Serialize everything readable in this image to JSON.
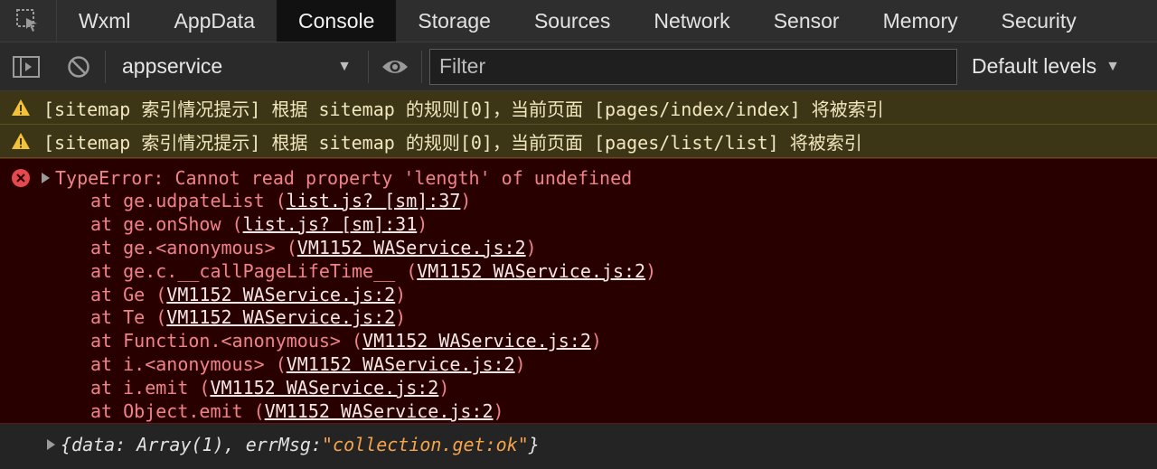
{
  "tabs": [
    {
      "label": "Wxml"
    },
    {
      "label": "AppData"
    },
    {
      "label": "Console",
      "active": true
    },
    {
      "label": "Storage"
    },
    {
      "label": "Sources"
    },
    {
      "label": "Network"
    },
    {
      "label": "Sensor"
    },
    {
      "label": "Memory"
    },
    {
      "label": "Security"
    }
  ],
  "toolbar": {
    "context": "appservice",
    "filter_placeholder": "Filter",
    "levels": "Default levels"
  },
  "console": {
    "warnings": [
      "[sitemap 索引情况提示] 根据 sitemap 的规则[0]，当前页面 [pages/index/index] 将被索引",
      "[sitemap 索引情况提示] 根据 sitemap 的规则[0]，当前页面 [pages/list/list] 将被索引"
    ],
    "error": {
      "message": "TypeError: Cannot read property 'length' of undefined",
      "frames": [
        {
          "fn": "at ge.udpateList (",
          "link": "list.js? [sm]:37",
          "end": ")"
        },
        {
          "fn": "at ge.onShow (",
          "link": "list.js? [sm]:31",
          "end": ")"
        },
        {
          "fn": "at ge.<anonymous> (",
          "link": "VM1152 WAService.js:2",
          "end": ")"
        },
        {
          "fn": "at ge.c.__callPageLifeTime__ (",
          "link": "VM1152 WAService.js:2",
          "end": ")"
        },
        {
          "fn": "at Ge (",
          "link": "VM1152 WAService.js:2",
          "end": ")"
        },
        {
          "fn": "at Te (",
          "link": "VM1152 WAService.js:2",
          "end": ")"
        },
        {
          "fn": "at Function.<anonymous> (",
          "link": "VM1152 WAService.js:2",
          "end": ")"
        },
        {
          "fn": "at i.<anonymous> (",
          "link": "VM1152 WAService.js:2",
          "end": ")"
        },
        {
          "fn": "at i.emit (",
          "link": "VM1152 WAService.js:2",
          "end": ")"
        },
        {
          "fn": "at Object.emit (",
          "link": "VM1152 WAService.js:2",
          "end": ")"
        }
      ]
    },
    "log": {
      "prefix": "{data: Array(1), errMsg: ",
      "string": "\"collection.get:ok\"",
      "suffix": "}"
    }
  },
  "colors": {
    "warning_bg": "#3c3616",
    "error_bg": "#290000",
    "error_text": "#f0828a",
    "string_orange": "#f6a34b"
  }
}
